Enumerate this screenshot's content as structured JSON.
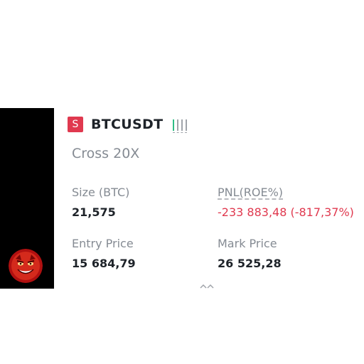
{
  "position": {
    "side_badge": "S",
    "symbol": "BTCUSDT",
    "leverage_bars": [
      "#2ebd85",
      "#a0a4aa",
      "#a0a4aa",
      "#a0a4aa"
    ],
    "margin_mode": "Cross 20X",
    "size_label": "Size (BTC)",
    "size_value": "21,575",
    "pnl_label": "PNL(ROE%)",
    "pnl_value": "-233 883,48 (-817,37%)",
    "entry_label": "Entry Price",
    "entry_value": "15 684,79",
    "mark_label": "Mark Price",
    "mark_value": "26 525,28"
  },
  "colors": {
    "negative": "#e0394f",
    "positive_bar": "#2ebd85",
    "label": "#858b93",
    "value": "#1e2329"
  },
  "icons": {
    "avatar": "red-devil-face-avatar",
    "scroll_hint": "chevron-up-icon"
  }
}
